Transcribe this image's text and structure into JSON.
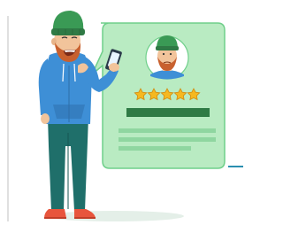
{
  "illustration": {
    "subject": "customer-review",
    "icons": [
      "person-icon",
      "smartphone-icon",
      "avatar-icon",
      "star-icon"
    ],
    "rating": {
      "value": 5,
      "max": 5
    },
    "colors": {
      "card_fill": "#b9ebc2",
      "card_stroke": "#6fcf8a",
      "bar_dark": "#2f7a45",
      "bar_light": "#8fd6a0",
      "star": "#f5b820",
      "star_stroke": "#d08a10",
      "hat": "#3a9a55",
      "hoodie": "#3e8fd6",
      "pants": "#1f6f6a",
      "shoes": "#e8553d",
      "skin": "#f2c49b",
      "beard": "#c8602e",
      "floor_line": "#2a8fb0"
    }
  }
}
